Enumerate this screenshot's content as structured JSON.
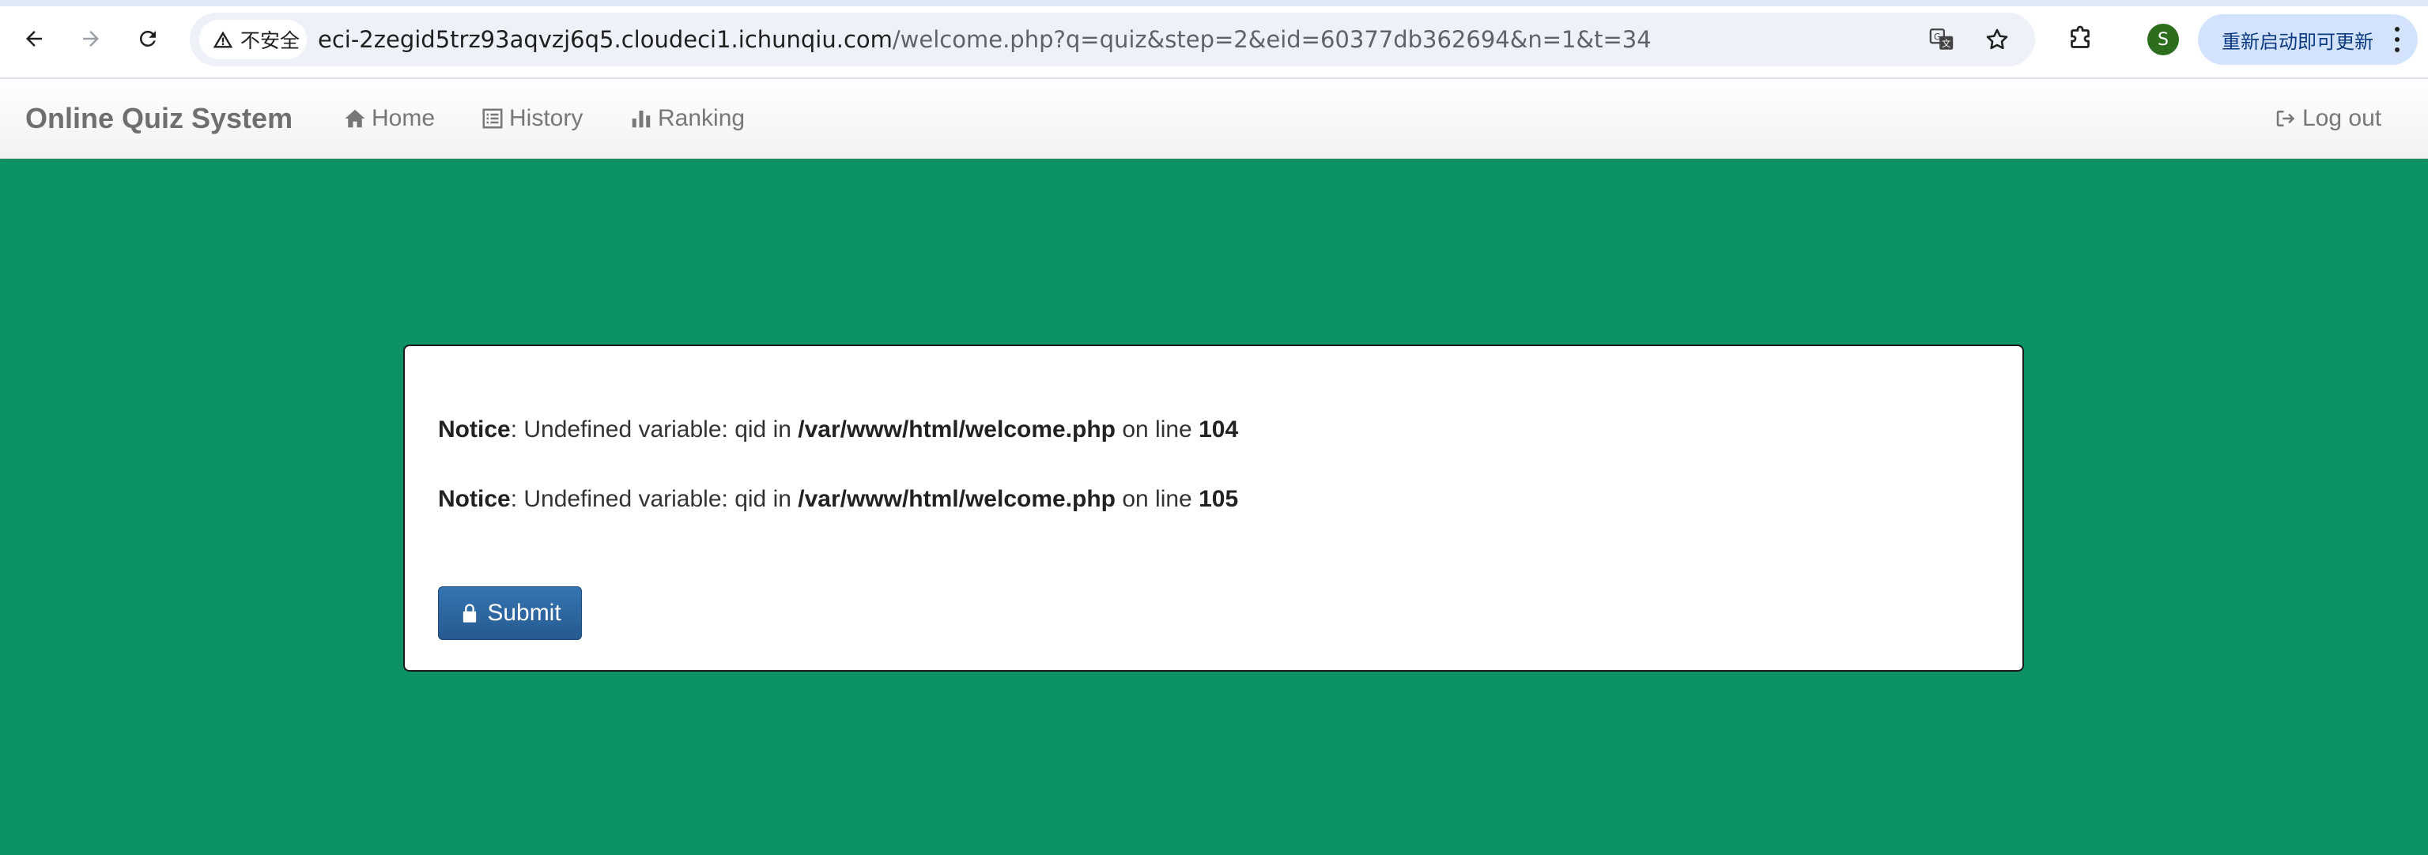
{
  "browser": {
    "security_label": "不安全",
    "url_host": "eci-2zegid5trz93aqvzj6q5.cloudeci1.ichunqiu.com",
    "url_path": "/welcome.php?q=quiz&step=2&eid=60377db362694&n=1&t=34",
    "profile_initial": "S",
    "update_label": "重新启动即可更新"
  },
  "navbar": {
    "brand": "Online Quiz System",
    "links": [
      {
        "label": "Home",
        "icon": "home-icon"
      },
      {
        "label": "History",
        "icon": "list-icon"
      },
      {
        "label": "Ranking",
        "icon": "bar-chart-icon"
      }
    ],
    "logout_label": "Log out"
  },
  "notices": [
    {
      "prefix": "Notice",
      "message": ": Undefined variable: qid in ",
      "file": "/var/www/html/welcome.php",
      "mid": " on line ",
      "line": "104"
    },
    {
      "prefix": "Notice",
      "message": ": Undefined variable: qid in ",
      "file": "/var/www/html/welcome.php",
      "mid": " on line ",
      "line": "105"
    }
  ],
  "submit_label": "Submit",
  "colors": {
    "page_background": "#0d9263",
    "submit_button": "#2e6aa6"
  }
}
